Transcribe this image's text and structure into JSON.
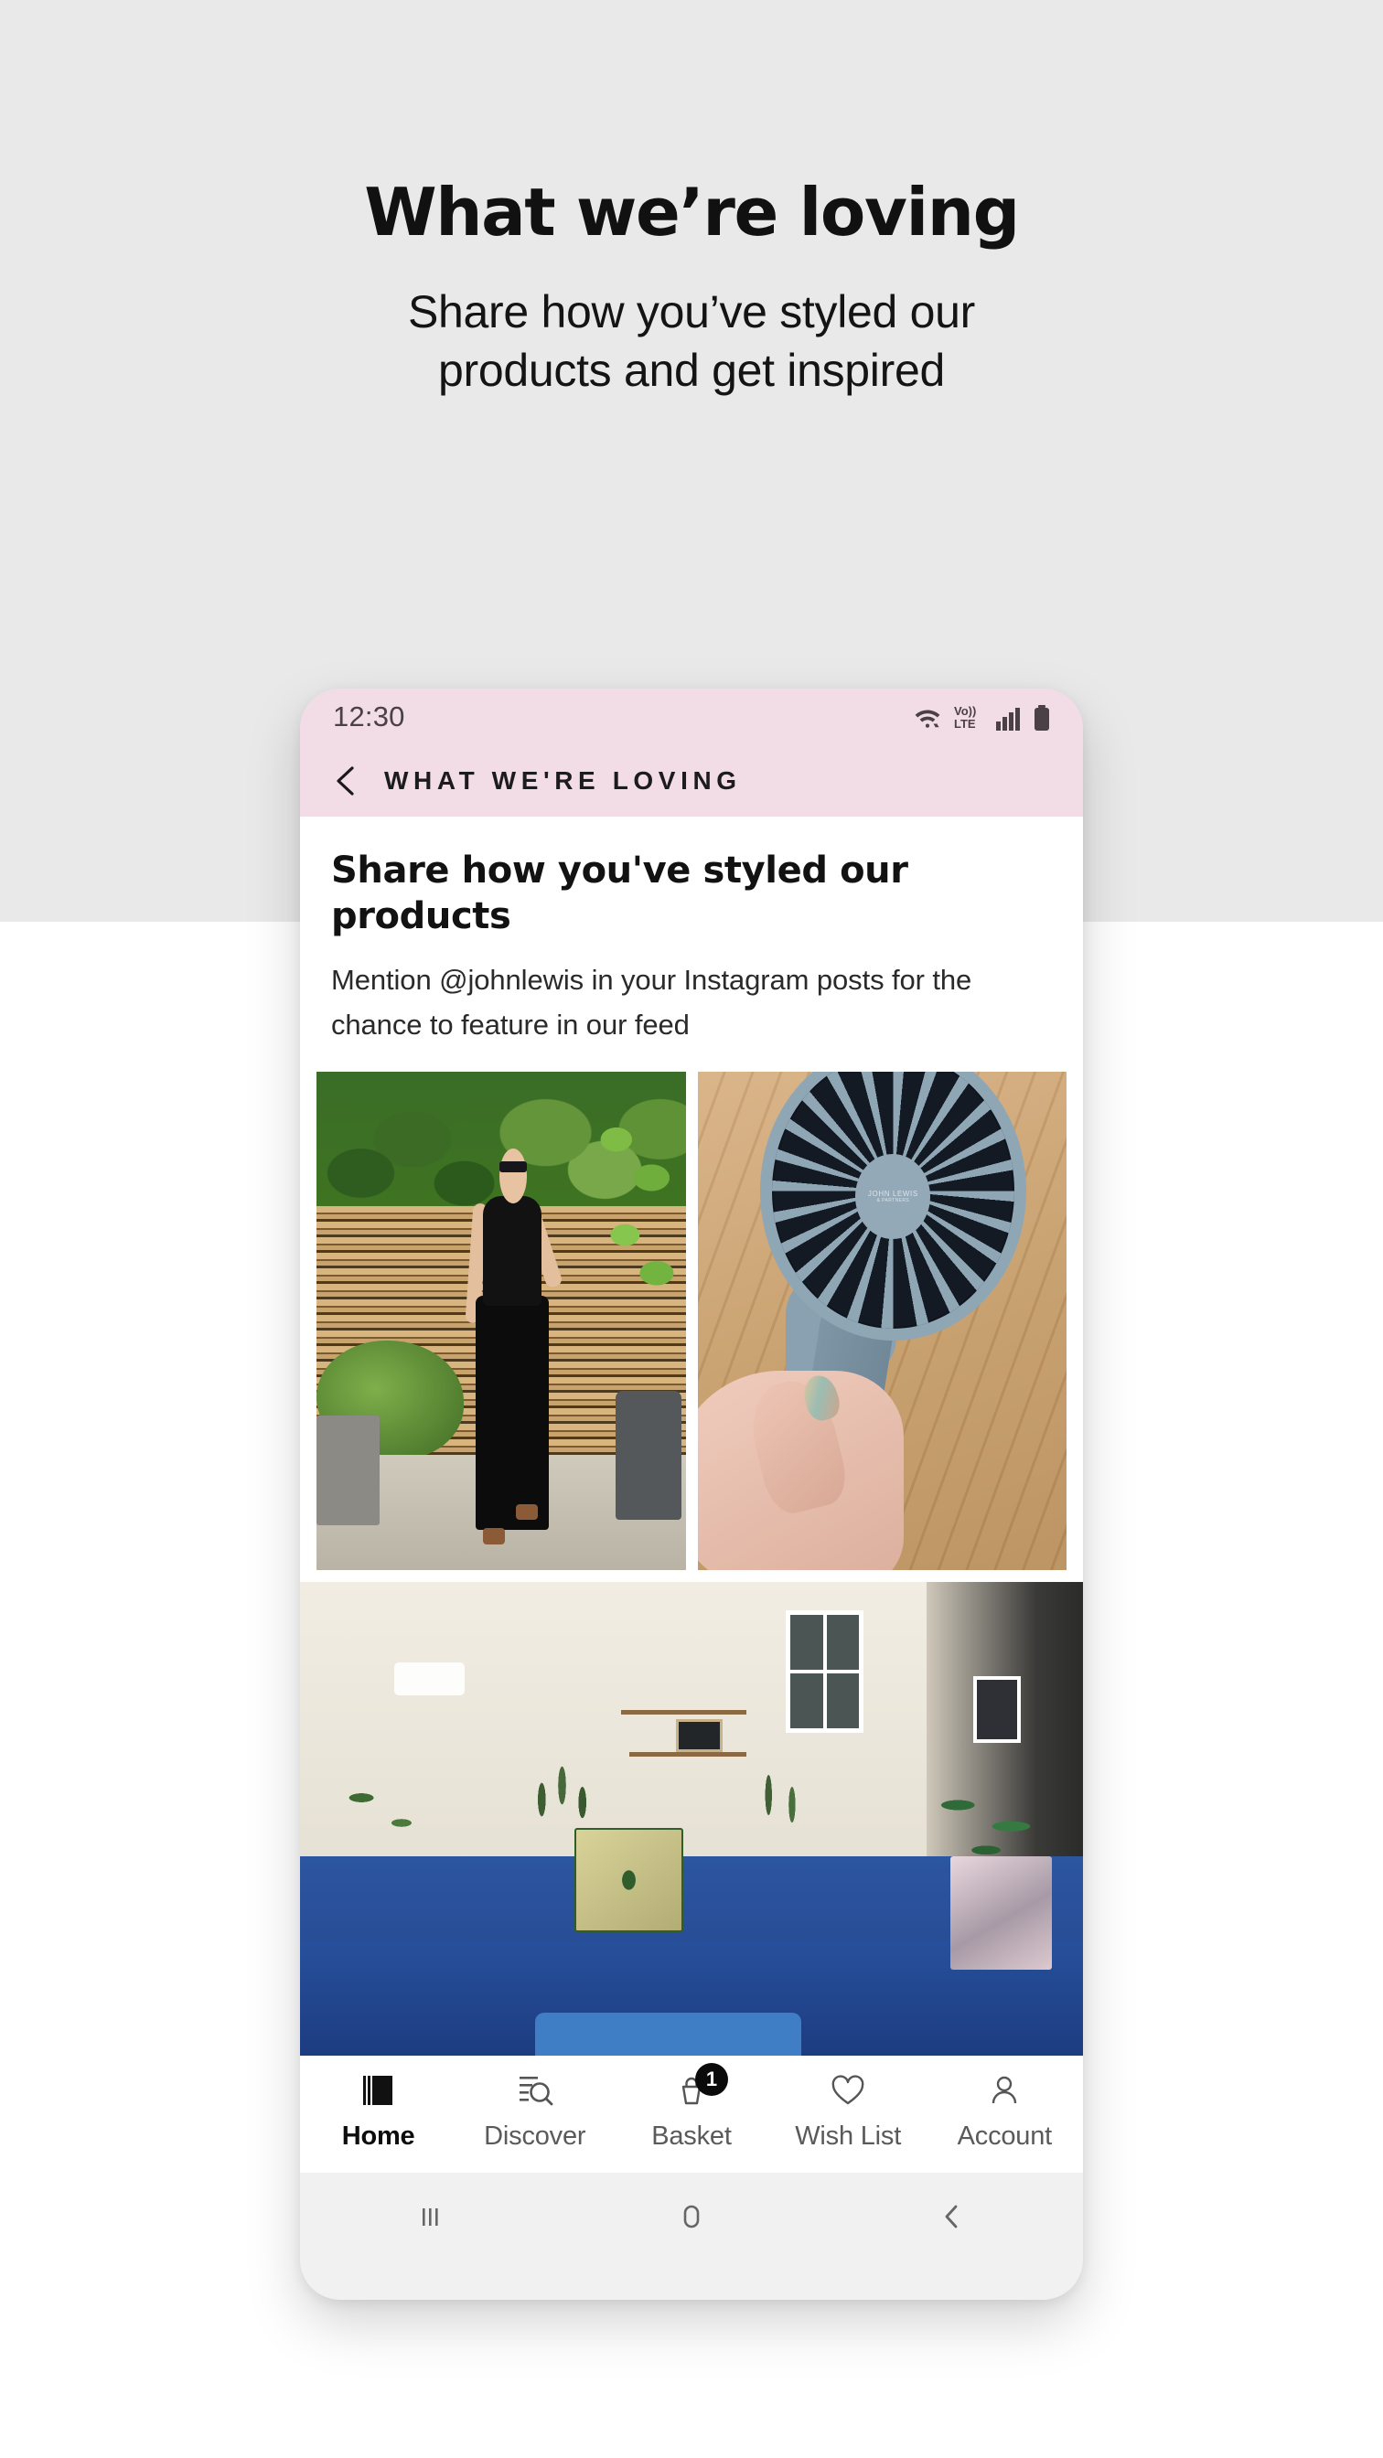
{
  "promo": {
    "title": "What we’re loving",
    "subtitle_line1": "Share how you’ve styled our",
    "subtitle_line2": "products and get inspired"
  },
  "phone": {
    "status_bar": {
      "time": "12:30",
      "icons": [
        "wifi-icon",
        "volte-icon",
        "signal-icon",
        "battery-icon"
      ],
      "volte_top": "Vo))",
      "volte_bottom": "LTE",
      "background_color": "#F2DCE6"
    },
    "app_bar": {
      "back_icon": "chevron-left-icon",
      "title": "WHAT WE'RE LOVING",
      "background_color": "#F2DCE6"
    },
    "content": {
      "heading": "Share how you've styled our products",
      "body": "Mention @johnlewis in your Instagram posts for the chance to feature in our feed"
    },
    "gallery": [
      {
        "name": "photo-woman-black-outfit-garden",
        "alt": "Woman in black top and trousers standing in front of a slatted wooden fence"
      },
      {
        "name": "photo-handheld-fan",
        "alt": "Hand holding a blue-grey John Lewis handheld fan over a wooden floor"
      },
      {
        "name": "photo-blue-corner-sofa-living-room",
        "alt": "Blue corner sofa in a plant-filled living room"
      }
    ],
    "hub_brand_line1": "JOHN LEWIS",
    "hub_brand_line2": "& PARTNERS",
    "bottom_nav": [
      {
        "label": "Home",
        "icon": "home-logo-icon",
        "active": true,
        "badge": ""
      },
      {
        "label": "Discover",
        "icon": "search-list-icon",
        "active": false,
        "badge": ""
      },
      {
        "label": "Basket",
        "icon": "basket-icon",
        "active": false,
        "badge": "1"
      },
      {
        "label": "Wish List",
        "icon": "heart-icon",
        "active": false,
        "badge": ""
      },
      {
        "label": "Account",
        "icon": "person-icon",
        "active": false,
        "badge": ""
      }
    ],
    "system_nav": [
      {
        "name": "recents-button",
        "icon": "recents-icon"
      },
      {
        "name": "home-button",
        "icon": "home-pill-icon"
      },
      {
        "name": "back-button",
        "icon": "back-chevron-icon"
      }
    ]
  },
  "colors": {
    "page_top": "#E9E9E9",
    "page_bottom": "#FFFFFF",
    "brand_pink": "#F2DCE6",
    "badge": "#0B0B0B"
  }
}
